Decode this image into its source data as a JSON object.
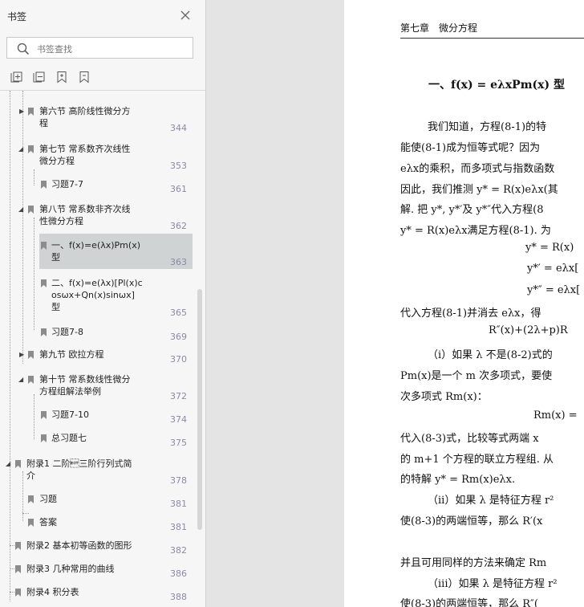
{
  "sidebar": {
    "title": "书签",
    "search_placeholder": "书签查找",
    "items": [
      {
        "l1": "第六节 高阶线性微分方",
        "l2": "程",
        "page": "344"
      },
      {
        "l1": "第七节 常系数齐次线性",
        "l2": "微分方程",
        "page": "353"
      },
      {
        "l1": "习题7-7",
        "page": "361"
      },
      {
        "l1": "第八节 常系数非齐次线",
        "l2": "性微分方程",
        "page": "362"
      },
      {
        "l1": "一、f(x)=e(λx)Pm(x)",
        "l2": "型",
        "page": "363"
      },
      {
        "l1": "二、f(x)=e(λx)[Pl(x)c",
        "l2": "osωx+Qn(x)sinωx]",
        "l3": "型",
        "page": "365"
      },
      {
        "l1": "习题7-8",
        "page": "369"
      },
      {
        "l1": "第九节 欧拉方程",
        "page": "370"
      },
      {
        "l1": "第十节 常系数线性微分",
        "l2": "方程组解法举例",
        "page": "372"
      },
      {
        "l1": "习题7-10",
        "page": "374"
      },
      {
        "l1": "总习题七",
        "page": "375"
      },
      {
        "l1": "附录1 二阶\u0004三阶行列式简",
        "l2": "介",
        "page": "378"
      },
      {
        "l1": "习题",
        "page": "381"
      },
      {
        "l1": "答案",
        "page": "381"
      },
      {
        "l1": "附录2 基本初等函数的图形",
        "page": "382"
      },
      {
        "l1": "附录3 几种常用的曲线",
        "page": "386"
      },
      {
        "l1": "附录4 积分表",
        "page": "388"
      }
    ]
  },
  "page": {
    "header": "第七章　微分方程",
    "heading": "一、f(x) = eλxPm(x) 型",
    "lines": [
      "我们知道，方程(8-1)的特",
      "能使(8-1)成为恒等式呢？因为",
      "eλx的乘积，而多项式与指数函数",
      "因此，我们推测 y* = R(x)eλx(其",
      "解. 把 y*, y*′及 y*″代入方程(8",
      "y* = R(x)eλx满足方程(8-1). 为",
      "y* = R(x)",
      "y*′ = eλx[",
      "y*″ = eλx[",
      "代入方程(8-1)并消去 eλx，得",
      "R″(x)+(2λ+p)R",
      "（i）如果 λ 不是(8-2)式的",
      "Pm(x)是一个 m 次多项式，要使",
      "次多项式 Rm(x)：",
      "Rm(x) = ",
      "代入(8-3)式，比较等式两端 x",
      "的 m+1 个方程的联立方程组. 从",
      "的特解 y* = Rm(x)eλx.",
      "（ii）如果 λ 是特征方程 r²",
      "使(8-3)的两端恒等，那么 R′(x",
      "并且可用同样的方法来确定 Rm",
      "（iii）如果 λ 是特征方程 r²",
      "使(8-3)的两端恒等，那么 R″("
    ]
  }
}
